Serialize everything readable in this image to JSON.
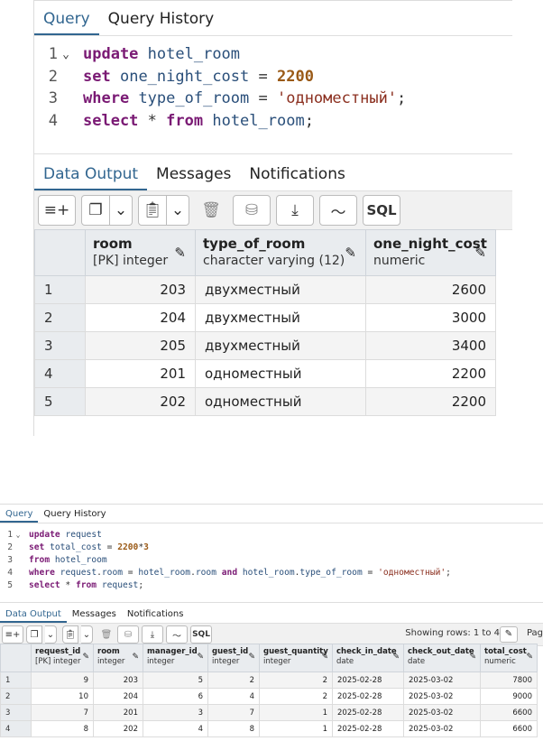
{
  "panel1": {
    "tabs": [
      "Query",
      "Query History"
    ],
    "code": [
      {
        "n": "1",
        "fold": "⌄",
        "tokens": [
          [
            "kw",
            "update"
          ],
          [
            "op",
            " "
          ],
          [
            "id",
            "hotel_room"
          ]
        ]
      },
      {
        "n": "2",
        "fold": "",
        "tokens": [
          [
            "kw",
            "set"
          ],
          [
            "op",
            " "
          ],
          [
            "id",
            "one_night_cost"
          ],
          [
            "op",
            " = "
          ],
          [
            "num",
            "2200"
          ]
        ]
      },
      {
        "n": "3",
        "fold": "",
        "tokens": [
          [
            "kw",
            "where"
          ],
          [
            "op",
            " "
          ],
          [
            "id",
            "type_of_room"
          ],
          [
            "op",
            " = "
          ],
          [
            "str",
            "'одноместный'"
          ],
          [
            "op",
            ";"
          ]
        ]
      },
      {
        "n": "4",
        "fold": "",
        "tokens": [
          [
            "kw",
            "select"
          ],
          [
            "op",
            " * "
          ],
          [
            "kw",
            "from"
          ],
          [
            "op",
            " "
          ],
          [
            "id",
            "hotel_room"
          ],
          [
            "op",
            ";"
          ]
        ]
      }
    ],
    "output_tabs": [
      "Data Output",
      "Messages",
      "Notifications"
    ],
    "sql_label": "SQL",
    "columns": [
      {
        "name": "room",
        "type": "[PK] integer"
      },
      {
        "name": "type_of_room",
        "type": "character varying (12)"
      },
      {
        "name": "one_night_cost",
        "type": "numeric"
      }
    ],
    "rows": [
      [
        "1",
        "203",
        "двухместный",
        "2600"
      ],
      [
        "2",
        "204",
        "двухместный",
        "3000"
      ],
      [
        "3",
        "205",
        "двухместный",
        "3400"
      ],
      [
        "4",
        "201",
        "одноместный",
        "2200"
      ],
      [
        "5",
        "202",
        "одноместный",
        "2200"
      ]
    ]
  },
  "panel2": {
    "tabs": [
      "Query",
      "Query History"
    ],
    "code": [
      {
        "n": "1",
        "fold": "⌄",
        "tokens": [
          [
            "kw",
            "update"
          ],
          [
            "op",
            " "
          ],
          [
            "id",
            "request"
          ]
        ]
      },
      {
        "n": "2",
        "fold": "",
        "tokens": [
          [
            "kw",
            "set"
          ],
          [
            "op",
            " "
          ],
          [
            "id",
            "total_cost"
          ],
          [
            "op",
            " = "
          ],
          [
            "num",
            "2200"
          ],
          [
            "op",
            "*"
          ],
          [
            "num",
            "3"
          ]
        ]
      },
      {
        "n": "3",
        "fold": "",
        "tokens": [
          [
            "kw",
            "from"
          ],
          [
            "op",
            " "
          ],
          [
            "id",
            "hotel_room"
          ]
        ]
      },
      {
        "n": "4",
        "fold": "",
        "tokens": [
          [
            "kw",
            "where"
          ],
          [
            "op",
            " "
          ],
          [
            "id",
            "request"
          ],
          [
            "op",
            "."
          ],
          [
            "id",
            "room"
          ],
          [
            "op",
            " = "
          ],
          [
            "id",
            "hotel_room"
          ],
          [
            "op",
            "."
          ],
          [
            "id",
            "room"
          ],
          [
            "op",
            " "
          ],
          [
            "kw",
            "and"
          ],
          [
            "op",
            " "
          ],
          [
            "id",
            "hotel_room"
          ],
          [
            "op",
            "."
          ],
          [
            "id",
            "type_of_room"
          ],
          [
            "op",
            " = "
          ],
          [
            "str",
            "'одноместный'"
          ],
          [
            "op",
            ";"
          ]
        ]
      },
      {
        "n": "5",
        "fold": "",
        "tokens": [
          [
            "kw",
            "select"
          ],
          [
            "op",
            " * "
          ],
          [
            "kw",
            "from"
          ],
          [
            "op",
            " "
          ],
          [
            "id",
            "request"
          ],
          [
            "op",
            ";"
          ]
        ]
      }
    ],
    "output_tabs": [
      "Data Output",
      "Messages",
      "Notifications"
    ],
    "sql_label": "SQL",
    "showing_rows": "Showing rows: 1 to 4",
    "pagination_label": "Pag",
    "columns": [
      {
        "name": "request_id",
        "type": "[PK] integer"
      },
      {
        "name": "room",
        "type": "integer"
      },
      {
        "name": "manager_id",
        "type": "integer"
      },
      {
        "name": "guest_id",
        "type": "integer"
      },
      {
        "name": "guest_quantity",
        "type": "integer"
      },
      {
        "name": "check_in_date",
        "type": "date"
      },
      {
        "name": "check_out_date",
        "type": "date"
      },
      {
        "name": "total_cost",
        "type": "numeric"
      }
    ],
    "rows": [
      [
        "1",
        "9",
        "203",
        "5",
        "2",
        "2",
        "2025-02-28",
        "2025-03-02",
        "7800"
      ],
      [
        "2",
        "10",
        "204",
        "6",
        "4",
        "2",
        "2025-02-28",
        "2025-03-02",
        "9000"
      ],
      [
        "3",
        "7",
        "201",
        "3",
        "7",
        "1",
        "2025-02-28",
        "2025-03-02",
        "6600"
      ],
      [
        "4",
        "8",
        "202",
        "4",
        "8",
        "1",
        "2025-02-28",
        "2025-03-02",
        "6600"
      ]
    ]
  }
}
